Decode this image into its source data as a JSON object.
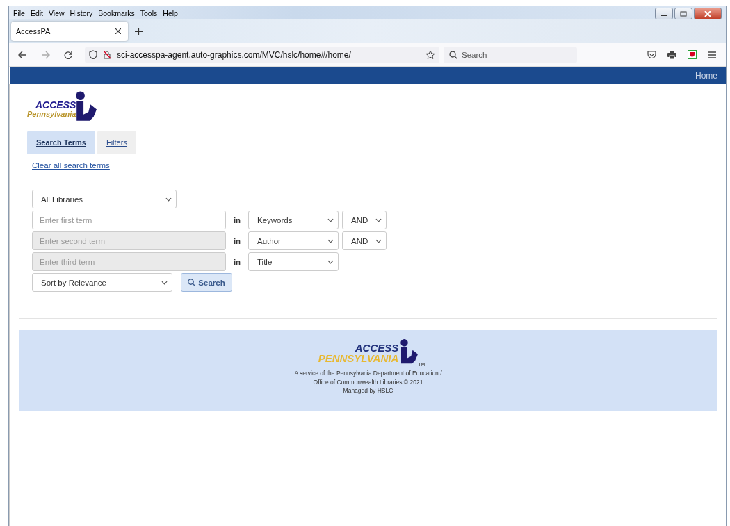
{
  "menu": [
    "File",
    "Edit",
    "View",
    "History",
    "Bookmarks",
    "Tools",
    "Help"
  ],
  "browser_tabs": [
    {
      "title": "AccessPA",
      "selected": true
    }
  ],
  "address_bar": {
    "url": "sci-accesspa-agent.auto-graphics.com/MVC/hslc/home#/home/"
  },
  "browser_search": {
    "placeholder": "Search"
  },
  "site_nav": {
    "links": [
      "Home"
    ]
  },
  "logo": {
    "top": "ACCESS",
    "bottom": "Pennsylvania"
  },
  "search_tabs": [
    {
      "label": "Search Terms",
      "selected": true
    },
    {
      "label": "Filters",
      "selected": false
    }
  ],
  "clear_link": "Clear all search terms",
  "library_select": "All Libraries",
  "term_rows": [
    {
      "placeholder": "Enter first term",
      "disabled": false,
      "in_label": "in",
      "field": "Keywords",
      "operator": "AND"
    },
    {
      "placeholder": "Enter second term",
      "disabled": true,
      "in_label": "in",
      "field": "Author",
      "operator": "AND"
    },
    {
      "placeholder": "Enter third term",
      "disabled": true,
      "in_label": "in",
      "field": "Title"
    }
  ],
  "sort_select": "Sort by Relevance",
  "search_button": "Search",
  "footer": {
    "logo_top": "ACCESS",
    "logo_bottom": "PENNSYLVANIA",
    "tm": "TM",
    "lines": [
      "A service of the Pennsylvania Department of Education /",
      "Office of Commonwealth Libraries © 2021",
      "Managed by HSLC"
    ]
  }
}
